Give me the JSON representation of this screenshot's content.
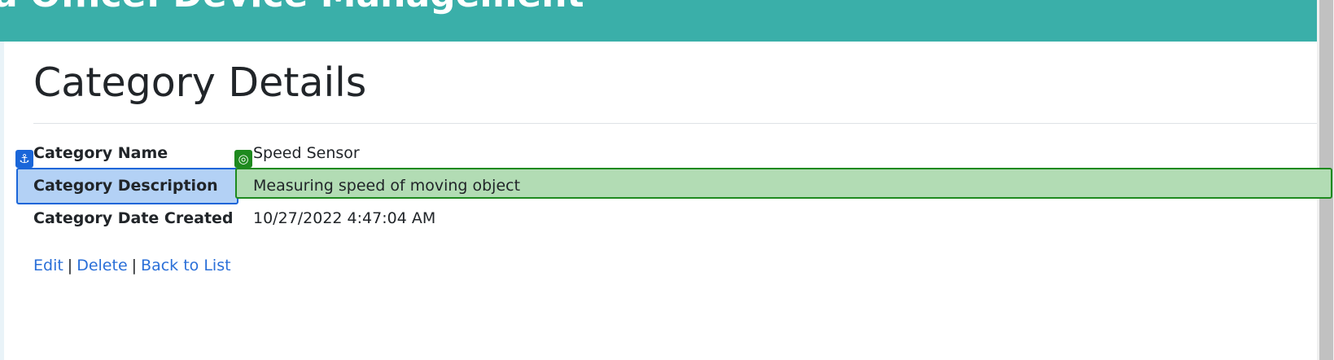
{
  "header": {
    "title": "a Office: Device Management"
  },
  "page": {
    "title": "Category Details"
  },
  "details": [
    {
      "label": "Category Name",
      "value": "Speed Sensor"
    },
    {
      "label": "Category Description",
      "value": "Measuring speed of moving object"
    },
    {
      "label": "Category Date Created",
      "value": "10/27/2022 4:47:04 AM"
    }
  ],
  "actions": {
    "edit": "Edit",
    "delete": "Delete",
    "back": "Back to List",
    "separator": "|"
  },
  "markers": {
    "anchor_icon": "⚓",
    "target_icon": "◎"
  },
  "colors": {
    "header_bg": "#3aafa9",
    "link": "#2a6fd8",
    "highlight_label_bg": "#b3d1f5",
    "highlight_label_border": "#1a66d9",
    "highlight_value_bg": "#b2dcb4",
    "highlight_value_border": "#1e8a1e"
  }
}
